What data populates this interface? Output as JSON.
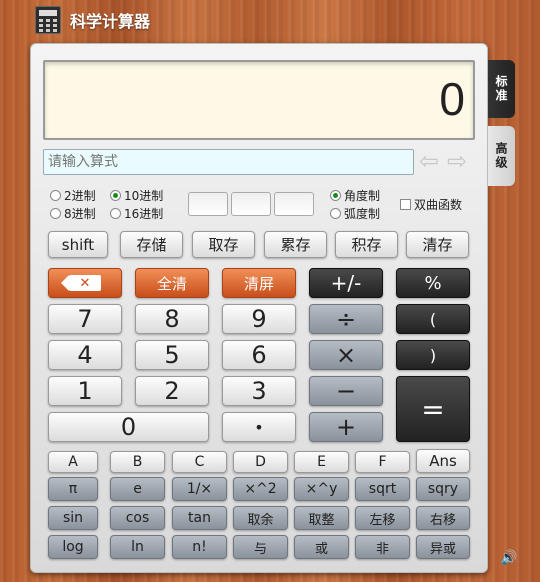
{
  "app": {
    "title": "科学计算器"
  },
  "tabs": {
    "standard": "标准",
    "advanced": "高级"
  },
  "display": {
    "value": "0"
  },
  "expression": {
    "placeholder": "请输入算式"
  },
  "base": {
    "bin": "2进制",
    "dec": "10进制",
    "oct": "8进制",
    "hex": "16进制",
    "selected": "10进制"
  },
  "angle": {
    "degree": "角度制",
    "radian": "弧度制",
    "selected": "角度制"
  },
  "hyperbolic": {
    "label": "双曲函数"
  },
  "memory_row": [
    "shift",
    "存储",
    "取存",
    "累存",
    "积存",
    "清存"
  ],
  "keys": {
    "backspace": "✕",
    "clear_all": "全清",
    "clear_screen": "清屏",
    "sign": "+/-",
    "percent": "%",
    "7": "7",
    "8": "8",
    "9": "9",
    "divide": "÷",
    "lparen": "(",
    "4": "4",
    "5": "5",
    "6": "6",
    "multiply": "×",
    "rparen": ")",
    "1": "1",
    "2": "2",
    "3": "3",
    "minus": "−",
    "equals": "=",
    "0": "0",
    "dot": "•",
    "plus": "+"
  },
  "hex_row": [
    "A",
    "B",
    "C",
    "D",
    "E",
    "F",
    "Ans"
  ],
  "sci_row1": [
    "π",
    "e",
    "1/×",
    "×^2",
    "×^y",
    "sqrt",
    "sqry"
  ],
  "sci_row2": [
    "sin",
    "cos",
    "tan",
    "取余",
    "取整",
    "左移",
    "右移"
  ],
  "sci_row3": [
    "log",
    "ln",
    "n!",
    "与",
    "或",
    "非",
    "异或"
  ]
}
